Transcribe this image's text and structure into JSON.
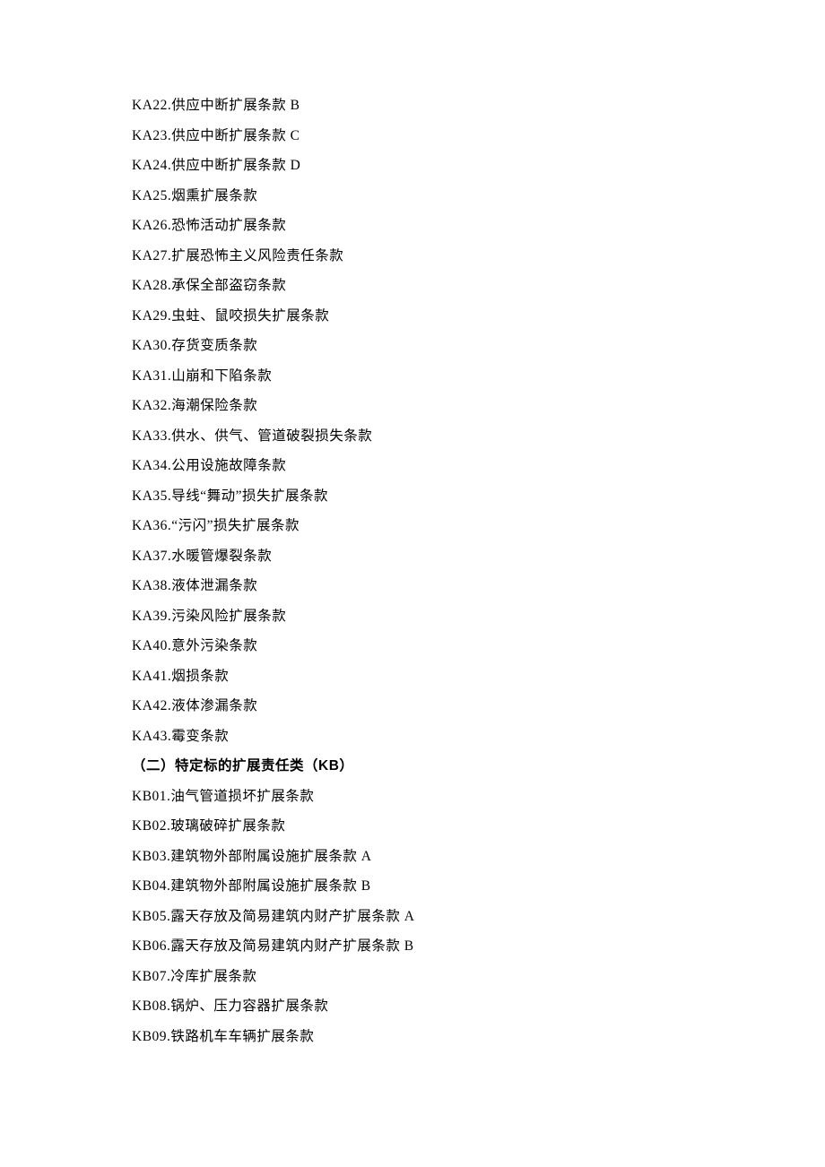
{
  "ka_clauses": [
    "KA22.供应中断扩展条款 B",
    "KA23.供应中断扩展条款 C",
    "KA24.供应中断扩展条款 D",
    "KA25.烟熏扩展条款",
    "KA26.恐怖活动扩展条款",
    "KA27.扩展恐怖主义风险责任条款",
    "KA28.承保全部盗窃条款",
    "KA29.虫蛀、鼠咬损失扩展条款",
    "KA30.存货变质条款",
    "KA31.山崩和下陷条款",
    "KA32.海潮保险条款",
    "KA33.供水、供气、管道破裂损失条款",
    "KA34.公用设施故障条款",
    "KA35.导线“舞动”损失扩展条款",
    "KA36.“污闪”损失扩展条款",
    "KA37.水暖管爆裂条款",
    "KA38.液体泄漏条款",
    "KA39.污染风险扩展条款",
    "KA40.意外污染条款",
    "KA41.烟损条款",
    "KA42.液体渗漏条款",
    "KA43.霉变条款"
  ],
  "section_heading": "（二）特定标的扩展责任类（KB）",
  "kb_clauses": [
    "KB01.油气管道损坏扩展条款",
    "KB02.玻璃破碎扩展条款",
    "KB03.建筑物外部附属设施扩展条款 A",
    "KB04.建筑物外部附属设施扩展条款 B",
    "KB05.露天存放及简易建筑内财产扩展条款 A",
    "KB06.露天存放及简易建筑内财产扩展条款 B",
    "KB07.冷库扩展条款",
    "KB08.锅炉、压力容器扩展条款",
    "KB09.铁路机车车辆扩展条款"
  ]
}
